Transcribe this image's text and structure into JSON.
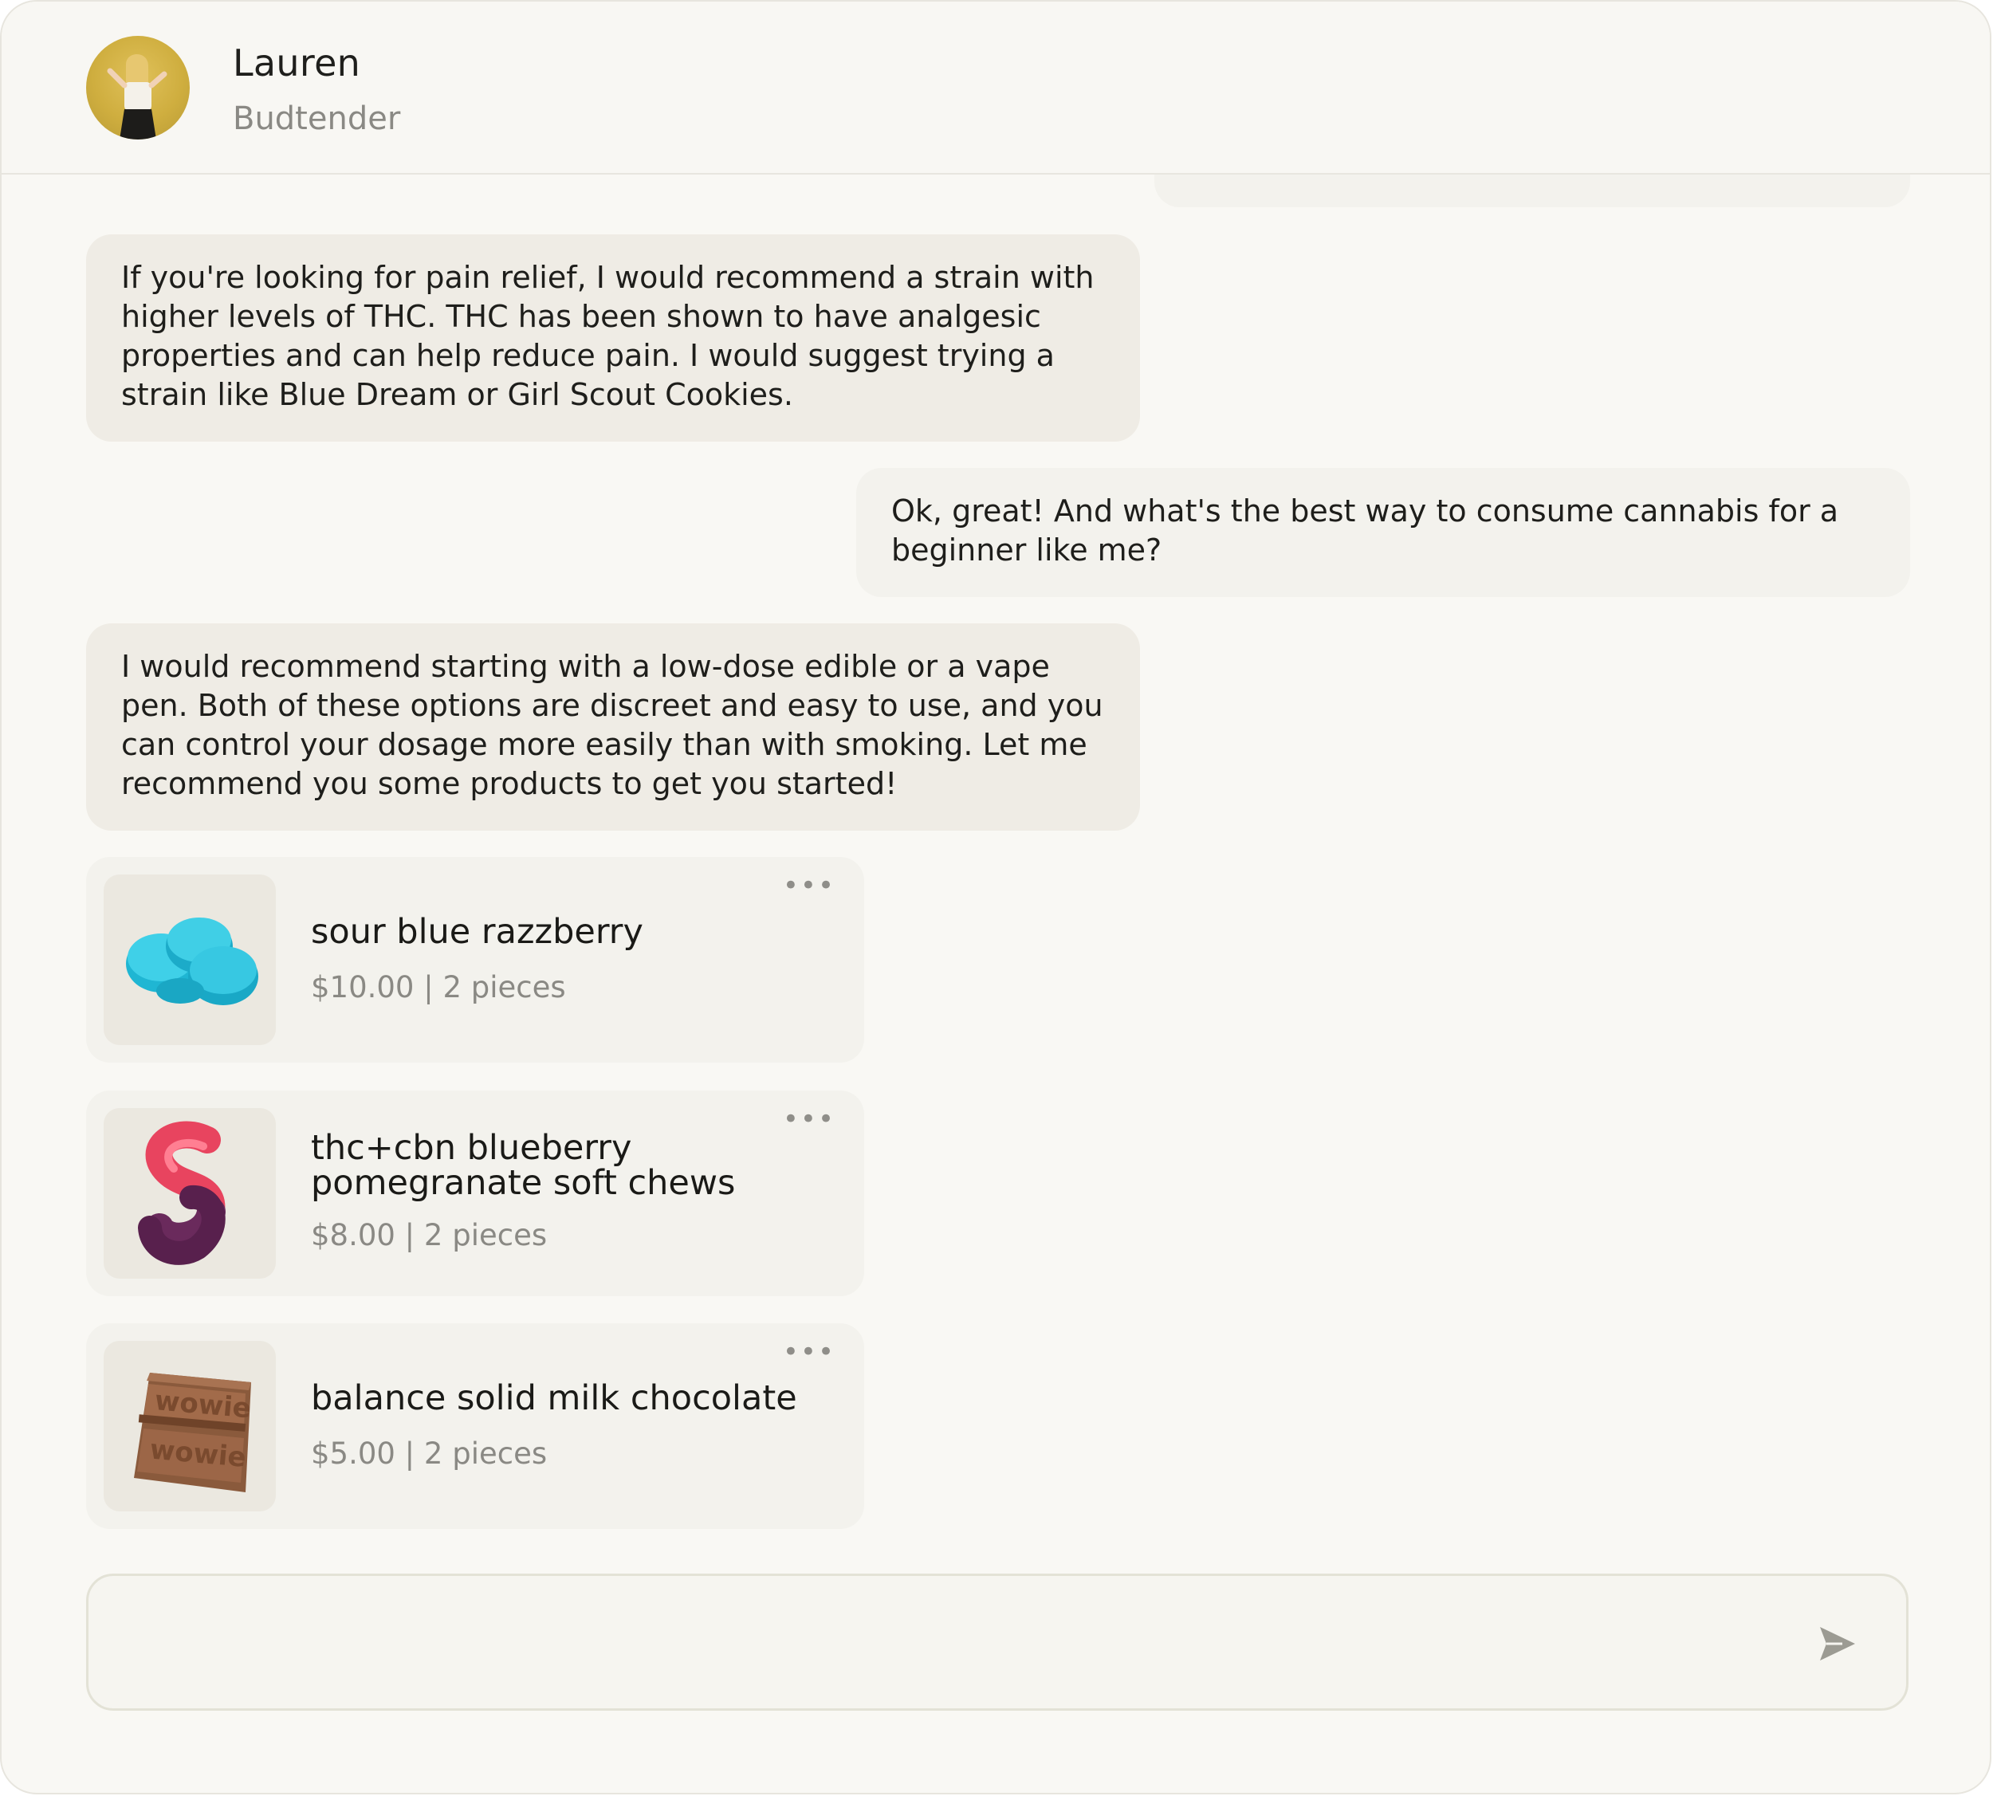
{
  "header": {
    "name": "Lauren",
    "role": "Budtender"
  },
  "messages": [
    {
      "sender": "bot",
      "text": "If you're looking for pain relief, I would recommend a strain with higher levels of THC. THC has been shown to have analgesic properties and can help reduce pain. I would suggest trying a strain like Blue Dream or Girl Scout Cookies."
    },
    {
      "sender": "user",
      "text": "Ok, great! And what's the best way to consume cannabis for a beginner like me?"
    },
    {
      "sender": "bot",
      "text": "I would recommend starting with a low-dose edible or a vape pen. Both of these options are discreet and easy to use, and you can control your dosage more easily than with smoking. Let me recommend you some products to get you started!"
    }
  ],
  "products": [
    {
      "title": "sour blue razzberry",
      "price": "$10.00 | 2 pieces",
      "image_icon": "blue-gummies"
    },
    {
      "title": "thc+cbn blueberry pomegranate soft chews",
      "price": "$8.00 | 2 pieces",
      "image_icon": "swirl-gummy"
    },
    {
      "title": "balance solid milk chocolate",
      "price": "$5.00 | 2 pieces",
      "image_icon": "chocolate-bar",
      "image_text": "wowie"
    }
  ],
  "product_menu_label": "•••",
  "composer": {
    "value": "",
    "placeholder": "",
    "send_icon": "send-icon"
  },
  "colors": {
    "background": "#f9f8f4",
    "bot_bubble": "#efece5",
    "user_bubble": "#f3f2ed",
    "muted_text": "#8a8984"
  }
}
